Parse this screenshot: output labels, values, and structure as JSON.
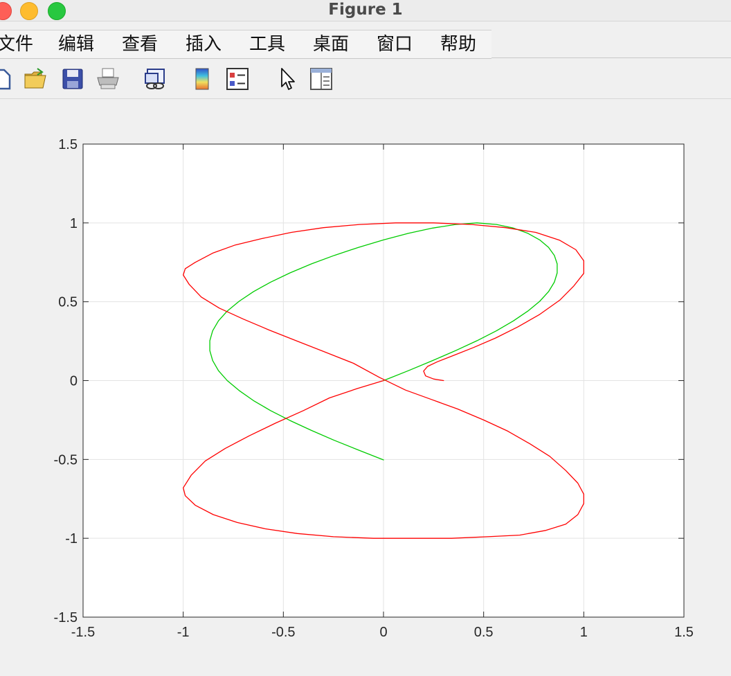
{
  "window": {
    "title": "Figure 1"
  },
  "menu": {
    "items": [
      "文件",
      "编辑",
      "查看",
      "插入",
      "工具",
      "桌面",
      "窗口",
      "帮助"
    ]
  },
  "toolbar": {
    "tools": [
      {
        "icon": "new-figure-icon"
      },
      {
        "icon": "open-folder-icon"
      },
      {
        "icon": "save-icon"
      },
      {
        "icon": "print-icon"
      },
      {
        "icon": "link-plot-icon"
      },
      {
        "icon": "colorbar-icon"
      },
      {
        "icon": "legend-icon"
      },
      {
        "icon": "edit-plot-arrow-icon"
      },
      {
        "icon": "property-inspector-icon"
      }
    ]
  },
  "colors": {
    "series_green": "#00cc00",
    "series_red": "#ff0000",
    "grid": "#e3e3e3",
    "axes": "#262626"
  },
  "chart_data": {
    "type": "line",
    "title": "",
    "xlabel": "",
    "ylabel": "",
    "xlim": [
      -1.5,
      1.5
    ],
    "ylim": [
      -1.5,
      1.5
    ],
    "xticks": [
      -1.5,
      -1,
      -0.5,
      0,
      0.5,
      1,
      1.5
    ],
    "yticks": [
      -1.5,
      -1,
      -0.5,
      0,
      0.5,
      1,
      1.5
    ],
    "xtick_labels": [
      "-1.5",
      "-1",
      "-0.5",
      "0",
      "0.5",
      "1",
      "1.5"
    ],
    "ytick_labels": [
      "-1.5",
      "-1",
      "-0.5",
      "0",
      "0.5",
      "1",
      "1.5"
    ],
    "grid": true,
    "legend": "none",
    "series": [
      {
        "color": "#00cc00",
        "x": [
          0,
          0.124,
          0.245,
          0.36,
          0.467,
          0.564,
          0.649,
          0.721,
          0.78,
          0.824,
          0.853,
          0.867,
          0.867,
          0.853,
          0.824,
          0.78,
          0.721,
          0.649,
          0.564,
          0.467,
          0.36,
          0.245,
          0.124,
          0,
          -0.124,
          -0.245,
          -0.36,
          -0.467,
          -0.564,
          -0.649,
          -0.721,
          -0.78,
          -0.824,
          -0.853,
          -0.867,
          -0.867,
          -0.853,
          -0.824,
          -0.78,
          -0.721,
          -0.649,
          -0.564,
          -0.467,
          -0.36,
          -0.245,
          -0.124,
          0
        ],
        "y": [
          0,
          0.063,
          0.127,
          0.19,
          0.253,
          0.316,
          0.379,
          0.441,
          0.503,
          0.564,
          0.624,
          0.683,
          0.74,
          0.794,
          0.845,
          0.892,
          0.934,
          0.967,
          0.99,
          1.0,
          0.99,
          0.967,
          0.934,
          0.892,
          0.845,
          0.794,
          0.74,
          0.683,
          0.624,
          0.564,
          0.503,
          0.441,
          0.379,
          0.316,
          0.253,
          0.19,
          0.127,
          0.063,
          0,
          -0.063,
          -0.127,
          -0.19,
          -0.253,
          -0.316,
          -0.379,
          -0.441,
          -0.503
        ]
      },
      {
        "color": "#ff0000",
        "x": [
          0.3,
          0.25,
          0.21,
          0.2,
          0.22,
          0.27,
          0.35,
          0.45,
          0.56,
          0.67,
          0.78,
          0.88,
          0.95,
          1.0,
          1.0,
          0.96,
          0.88,
          0.76,
          0.61,
          0.44,
          0.25,
          0.06,
          -0.12,
          -0.3,
          -0.46,
          -0.61,
          -0.74,
          -0.85,
          -0.94,
          -0.99,
          -1.0,
          -0.97,
          -0.91,
          -0.82,
          -0.7,
          -0.57,
          -0.43,
          -0.29,
          -0.15,
          -0.02,
          0.11,
          0.24,
          0.37,
          0.5,
          0.62,
          0.73,
          0.83,
          0.91,
          0.97,
          1.0,
          1.0,
          0.97,
          0.91,
          0.81,
          0.68,
          0.52,
          0.34,
          0.15,
          -0.05,
          -0.25,
          -0.43,
          -0.59,
          -0.73,
          -0.85,
          -0.94,
          -0.99,
          -1.0,
          -0.96,
          -0.89,
          -0.79,
          -0.67,
          -0.54,
          -0.4,
          -0.27,
          -0.13,
          0.0
        ],
        "y": [
          0.0,
          0.01,
          0.03,
          0.06,
          0.09,
          0.12,
          0.16,
          0.21,
          0.27,
          0.34,
          0.42,
          0.51,
          0.6,
          0.68,
          0.76,
          0.83,
          0.89,
          0.94,
          0.97,
          0.99,
          1.0,
          1.0,
          0.99,
          0.97,
          0.94,
          0.9,
          0.86,
          0.81,
          0.75,
          0.71,
          0.67,
          0.61,
          0.53,
          0.46,
          0.39,
          0.32,
          0.25,
          0.18,
          0.11,
          0.02,
          -0.06,
          -0.12,
          -0.18,
          -0.25,
          -0.32,
          -0.4,
          -0.48,
          -0.57,
          -0.65,
          -0.72,
          -0.78,
          -0.85,
          -0.91,
          -0.95,
          -0.98,
          -0.99,
          -1.0,
          -1.0,
          -1.0,
          -0.99,
          -0.97,
          -0.94,
          -0.9,
          -0.85,
          -0.79,
          -0.73,
          -0.68,
          -0.6,
          -0.51,
          -0.43,
          -0.35,
          -0.27,
          -0.19,
          -0.11,
          -0.05,
          0.0
        ]
      }
    ]
  }
}
